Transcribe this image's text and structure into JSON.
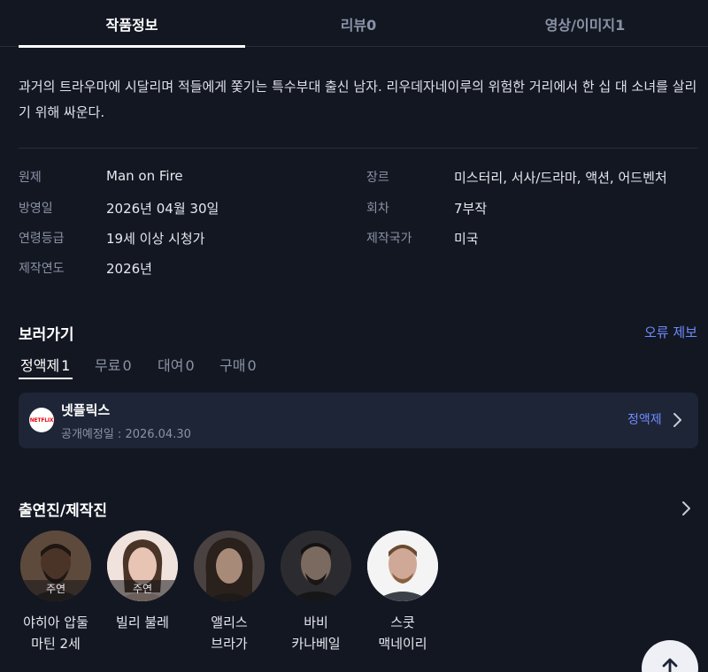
{
  "tabs": [
    {
      "label": "작품정보",
      "active": true
    },
    {
      "label": "리뷰0",
      "active": false
    },
    {
      "label": "영상/이미지1",
      "active": false
    }
  ],
  "synopsis": "과거의 트라우마에 시달리며 적들에게 쫓기는 특수부대 출신 남자. 리우데자네이루의 위험한 거리에서 한 십 대 소녀를 살리기 위해 싸운다.",
  "info": {
    "left": [
      {
        "label": "원제",
        "value": "Man on Fire"
      },
      {
        "label": "방영일",
        "value": "2026년 04월 30일"
      },
      {
        "label": "연령등급",
        "value": "19세 이상 시청가"
      },
      {
        "label": "제작연도",
        "value": "2026년"
      }
    ],
    "right": [
      {
        "label": "장르",
        "value": "미스터리, 서사/드라마, 액션, 어드벤처"
      },
      {
        "label": "회차",
        "value": "7부작"
      },
      {
        "label": "제작국가",
        "value": "미국"
      }
    ]
  },
  "watch": {
    "title": "보러가기",
    "report_label": "오류 제보",
    "sub_tabs": [
      {
        "label": "정액제",
        "count": "1",
        "active": true
      },
      {
        "label": "무료",
        "count": "0",
        "active": false
      },
      {
        "label": "대여",
        "count": "0",
        "active": false
      },
      {
        "label": "구매",
        "count": "0",
        "active": false
      }
    ],
    "provider": {
      "logo_text": "NETFLIX",
      "name": "넷플릭스",
      "date": "공개예정일 : 2026.04.30",
      "type": "정액제"
    }
  },
  "cast": {
    "title": "출연진/제작진",
    "people": [
      {
        "name": "야히아 압둘 마틴 2세",
        "role": "주연",
        "skin": "#4a3428",
        "bg": "#6b5444"
      },
      {
        "name": "빌리 불레",
        "role": "주연",
        "skin": "#e8c4b4",
        "bg": "#f0ded6"
      },
      {
        "name": "앨리스 브라가",
        "role": "",
        "skin": "#9a8070",
        "bg": "#3a3230"
      },
      {
        "name": "바비 카나베일",
        "role": "",
        "skin": "#7a6a60",
        "bg": "#2a2a2e"
      },
      {
        "name": "스쿳 맥네이리",
        "role": "",
        "skin": "#d0a898",
        "bg": "#f2f2f2"
      }
    ]
  },
  "colors": {
    "background": "#131722",
    "card": "#1e2536",
    "accent": "#6f8cff",
    "netflix_red": "#e50914"
  }
}
